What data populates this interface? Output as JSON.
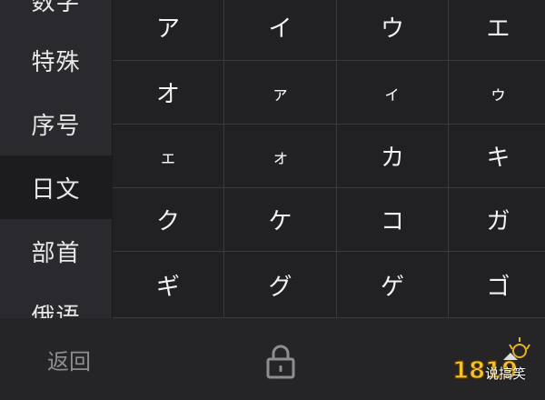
{
  "sidebar": {
    "items": [
      {
        "label": "数字"
      },
      {
        "label": "特殊"
      },
      {
        "label": "序号"
      },
      {
        "label": "日文"
      },
      {
        "label": "部首"
      },
      {
        "label": "俄语"
      }
    ]
  },
  "grid": {
    "keys": [
      "ア",
      "イ",
      "ウ",
      "エ",
      "オ",
      "ァ",
      "ィ",
      "ゥ",
      "ェ",
      "ォ",
      "カ",
      "キ",
      "ク",
      "ケ",
      "コ",
      "ガ",
      "ギ",
      "グ",
      "ゲ",
      "ゴ"
    ]
  },
  "bottom": {
    "back_label": "返回",
    "lock_icon": "lock-icon"
  },
  "watermark": {
    "text": "说搞笑",
    "logo": "1819"
  },
  "colors": {
    "background": "#212124",
    "sidebar": "#2a2a2e",
    "active": "#1c1c1f",
    "key_text": "#f2f2f2",
    "muted_text": "#8d8d92"
  }
}
